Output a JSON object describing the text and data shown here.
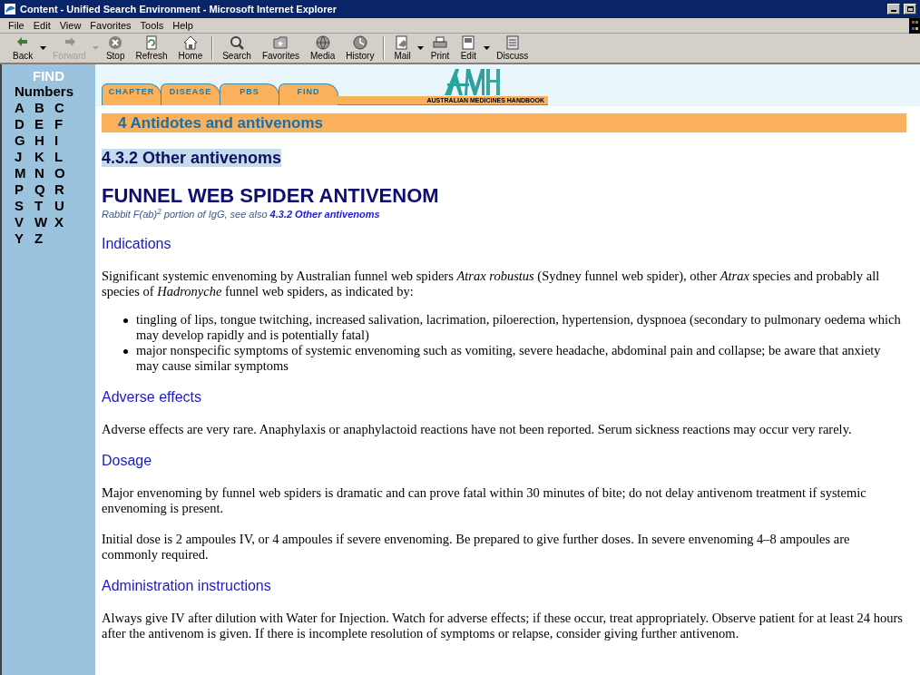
{
  "window": {
    "title": "Content - Unified Search Environment - Microsoft Internet Explorer"
  },
  "menu": [
    "File",
    "Edit",
    "View",
    "Favorites",
    "Tools",
    "Help"
  ],
  "toolbar": [
    {
      "label": "Back",
      "disabled": false,
      "dropdown": true
    },
    {
      "label": "Forward",
      "disabled": true,
      "dropdown": true
    },
    {
      "label": "Stop",
      "disabled": false,
      "dropdown": false
    },
    {
      "label": "Refresh",
      "disabled": false,
      "dropdown": false
    },
    {
      "label": "Home",
      "disabled": false,
      "dropdown": false
    },
    {
      "label": "Search",
      "disabled": false,
      "dropdown": false
    },
    {
      "label": "Favorites",
      "disabled": false,
      "dropdown": false
    },
    {
      "label": "Media",
      "disabled": false,
      "dropdown": false
    },
    {
      "label": "History",
      "disabled": false,
      "dropdown": false
    },
    {
      "label": "Mail",
      "disabled": false,
      "dropdown": true
    },
    {
      "label": "Print",
      "disabled": false,
      "dropdown": false
    },
    {
      "label": "Edit",
      "disabled": false,
      "dropdown": true
    },
    {
      "label": "Discuss",
      "disabled": false,
      "dropdown": false
    }
  ],
  "sidebar": {
    "title": "FIND",
    "numbers": "Numbers",
    "letter_rows": [
      [
        "A",
        "B",
        "C"
      ],
      [
        "D",
        "E",
        "F"
      ],
      [
        "G",
        "H",
        "I"
      ],
      [
        "J",
        "K",
        "L"
      ],
      [
        "M",
        "N",
        "O"
      ],
      [
        "P",
        "Q",
        "R"
      ],
      [
        "S",
        "T",
        "U"
      ],
      [
        "V",
        "W",
        "X"
      ],
      [
        "Y",
        "Z"
      ]
    ]
  },
  "tabs": [
    "CHAPTER",
    "DISEASE",
    "PBS",
    "FIND"
  ],
  "logo": {
    "caption": "AUSTRALIAN MEDICINES HANDBOOK"
  },
  "chapter": "4 Antidotes and antivenoms",
  "section": "4.3.2 Other antivenoms",
  "drug": {
    "name": "FUNNEL WEB SPIDER ANTIVENOM",
    "subtitle": "Rabbit F(ab)$^{2}$ portion of IgG, see also",
    "link": "4.3.2 Other antivenoms"
  },
  "blocks": [
    {
      "kind": "heading",
      "text": "Indications"
    },
    {
      "kind": "para",
      "text": "Significant systemic envenoming by Australian funnel web spiders *Atrax robustus* (Sydney funnel web spider), other *Atrax* species and probably all species of *Hadronyche* funnel web spiders, as indicated by:"
    },
    {
      "kind": "list",
      "items": [
        "tingling of lips, tongue twitching, increased salivation, lacrimation, piloerection, hypertension, dyspnoea (secondary to pulmonary oedema which may develop rapidly and is potentially fatal)",
        "major nonspecific symptoms of systemic envenoming such as vomiting, severe headache, abdominal pain and collapse; be aware that anxiety may cause similar symptoms"
      ]
    },
    {
      "kind": "heading",
      "text": "Adverse effects"
    },
    {
      "kind": "para",
      "text": "Adverse effects are very rare. Anaphylaxis or anaphylactoid reactions have not been reported. Serum sickness reactions may occur very rarely."
    },
    {
      "kind": "heading",
      "text": "Dosage"
    },
    {
      "kind": "para",
      "text": "Major envenoming by funnel web spiders is dramatic and can prove fatal within 30 minutes of bite; do not delay antivenom treatment if systemic envenoming is present."
    },
    {
      "kind": "para",
      "text": "Initial dose is 2 ampoules IV, or 4 ampoules if severe envenoming. Be prepared to give further doses. In severe envenoming 4–8 ampoules are commonly required."
    },
    {
      "kind": "heading",
      "text": "Administration instructions"
    },
    {
      "kind": "para",
      "text": "Always give IV after dilution with Water for Injection. Watch for adverse effects; if these occur, treat appropriately. Observe patient for at least 24 hours after the antivenom is given. If there is incomplete resolution of symptoms or relapse, consider giving further antivenom."
    }
  ]
}
